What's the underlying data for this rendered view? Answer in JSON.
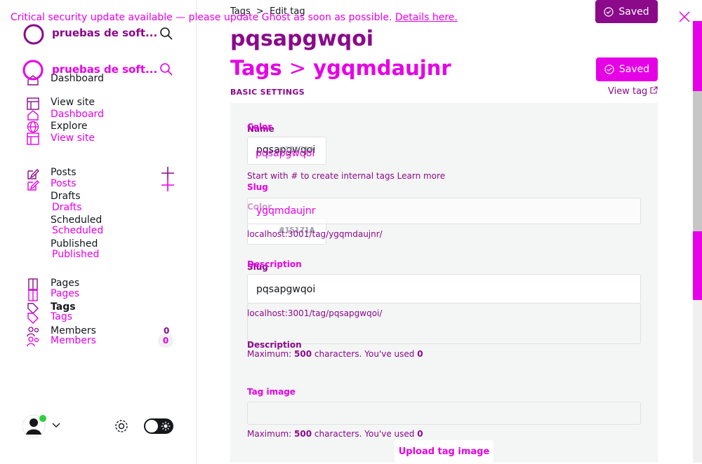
{
  "banner": {
    "text": "Critical security update available — please update Ghost as soon as possible.",
    "link": "Details here."
  },
  "site": {
    "name_back": "pruebas de soft...",
    "name_front": "pruebas de soft..."
  },
  "nav_back": {
    "dashboard": "Dashboard",
    "view_site": "View site",
    "posts": "Posts",
    "drafts": "Drafts",
    "scheduled": "Scheduled",
    "published": "Published",
    "pages": "Pages",
    "tags": "Tags",
    "members": "Members",
    "members_count": "0"
  },
  "nav_front": {
    "dashboard": "Dashboard",
    "explore": "Explore",
    "view_site": "View site",
    "posts": "Posts",
    "drafts": "Drafts",
    "scheduled": "Scheduled",
    "published": "Published",
    "pages": "Pages",
    "tags": "Tags",
    "members": "Members",
    "members_count": "0"
  },
  "header_back": {
    "breadcrumb_root": "Tags",
    "breadcrumb_sep": ">",
    "breadcrumb_current": "Edit tag",
    "title": "pqsapgwqoi",
    "saved": "Saved"
  },
  "header_front": {
    "breadcrumb_root": "Tags",
    "breadcrumb_sep": ">",
    "title": "ygqmdaujnr",
    "saved": "Saved",
    "section": "BASIC SETTINGS",
    "view_tag": "View tag"
  },
  "form_back": {
    "name_label": "Name",
    "name_value": "pqsapgwqoi",
    "color_label": "Color",
    "color_value": "#15171A",
    "slug_label": "Slug",
    "slug_value": "pqsapgwqoi",
    "slug_url": "localhost:3001/tag/pqsapgwqoi/",
    "description_label": "Description",
    "desc_max_prefix": "Maximum:",
    "desc_max_num": "500",
    "desc_used_text": "characters. You've used",
    "desc_used_num": "0"
  },
  "form_front": {
    "color_label": "Color",
    "color_value": "#15171A",
    "name_value": "pqsapgwqoi",
    "name_hint": "Start with # to create internal tags Learn more",
    "slug_label": "Slug",
    "slug_value": "ygqmdaujnr",
    "slug_url": "localhost:3001/tag/ygqmdaujnr/",
    "description_label": "Description",
    "desc_max_prefix": "Maximum:",
    "desc_max_num": "500",
    "desc_used_text": "characters. You've used",
    "desc_used_num": "0",
    "tag_image_label": "Tag image",
    "upload_label": "Upload tag image"
  },
  "colors": {
    "brand": "#e600e6",
    "dark_brand": "#8a0a8a",
    "panel": "#f4f5f5"
  }
}
